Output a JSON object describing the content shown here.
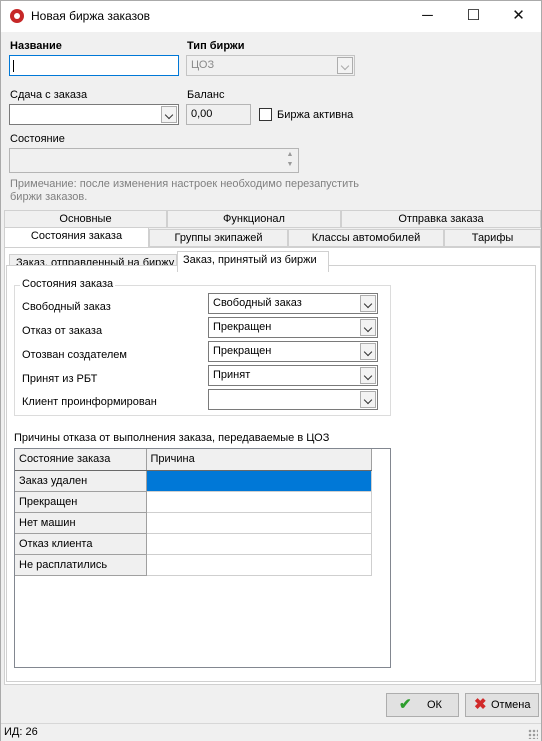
{
  "window": {
    "title": "Новая биржа заказов",
    "controls": [
      "─",
      "☐",
      "✕"
    ]
  },
  "fields": {
    "name_label": "Название",
    "name_value": "",
    "type_label": "Тип биржи",
    "type_value": "ЦОЗ",
    "change_label": "Сдача с заказа",
    "change_value": "",
    "balance_label": "Баланс",
    "balance_value": "0,00",
    "active_label": "Биржа активна",
    "active_checked": false,
    "state_label": "Состояние",
    "state_value": "",
    "note": "Примечание: после изменения настроек необходимо перезапустить биржи заказов."
  },
  "tabs": {
    "row1": [
      "Основные",
      "Функционал",
      "Отправка заказа"
    ],
    "row2": [
      "Состояния заказа",
      "Группы экипажей",
      "Классы автомобилей",
      "Тарифы"
    ],
    "active": "Состояния заказа"
  },
  "subtabs": {
    "items": [
      "Заказ, отправленный на биржу",
      "Заказ, принятый из биржи"
    ],
    "active": "Заказ, принятый из биржи"
  },
  "states_group": {
    "title": "Состояния заказа",
    "rows": [
      {
        "label": "Свободный заказ",
        "value": "Свободный заказ"
      },
      {
        "label": "Отказ от заказа",
        "value": "Прекращен"
      },
      {
        "label": "Отозван создателем",
        "value": "Прекращен"
      },
      {
        "label": "Принят из РБТ",
        "value": "Принят"
      },
      {
        "label": "Клиент проинформирован",
        "value": ""
      }
    ]
  },
  "reasons": {
    "title": "Причины отказа от выполнения заказа, передаваемые в ЦОЗ",
    "columns": [
      "Состояние заказа",
      "Причина"
    ],
    "rows": [
      {
        "state": "Заказ удален",
        "reason": ""
      },
      {
        "state": "Прекращен",
        "reason": ""
      },
      {
        "state": "Нет машин",
        "reason": ""
      },
      {
        "state": "Отказ клиента",
        "reason": ""
      },
      {
        "state": "Не расплатились",
        "reason": ""
      }
    ],
    "selected_row": 0
  },
  "buttons": {
    "ok": "ОК",
    "cancel": "Отмена"
  },
  "icons": {
    "ok": "checkmark-icon",
    "cancel": "cross-icon",
    "app": "app-icon"
  },
  "colors": {
    "selection": "#0078d7",
    "focus_border": "#0078d7",
    "ok_icon": "#2e9e2e",
    "cancel_icon": "#d12a2a"
  },
  "status": {
    "id": "ИД: 26"
  }
}
